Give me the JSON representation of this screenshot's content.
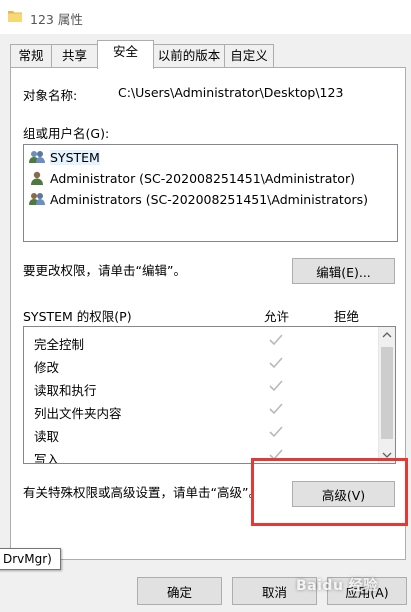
{
  "window": {
    "title": "123 属性"
  },
  "tabs": [
    {
      "label": "常规"
    },
    {
      "label": "共享"
    },
    {
      "label": "安全"
    },
    {
      "label": "以前的版本"
    },
    {
      "label": "自定义"
    }
  ],
  "security": {
    "object_label": "对象名称:",
    "object_value": "C:\\Users\\Administrator\\Desktop\\123",
    "groups_label": "组或用户名(G):",
    "groups": [
      {
        "name": "SYSTEM"
      },
      {
        "name": "Administrator (SC-202008251451\\Administrator)"
      },
      {
        "name": "Administrators (SC-202008251451\\Administrators)"
      }
    ],
    "change_hint": "要更改权限，请单击“编辑”。",
    "edit_button": "编辑(E)...",
    "perm_label": "SYSTEM 的权限(P)",
    "allow_header": "允许",
    "deny_header": "拒绝",
    "permissions": [
      {
        "name": "完全控制",
        "allow": true
      },
      {
        "name": "修改",
        "allow": true
      },
      {
        "name": "读取和执行",
        "allow": true
      },
      {
        "name": "列出文件夹内容",
        "allow": true
      },
      {
        "name": "读取",
        "allow": true
      },
      {
        "name": "写入",
        "allow": true
      }
    ],
    "advanced_hint": "有关特殊权限或高级设置，请单击“高级”。",
    "advanced_button": "高级(V)"
  },
  "tooltip": "DrvMgr)",
  "buttons": {
    "ok": "确定",
    "cancel": "取消",
    "apply": "应用(A)"
  },
  "watermark": "Baidu 经验",
  "colors": {
    "highlight": "#e53935",
    "selection": "#e5f3ff",
    "check": "#b9b9b9"
  }
}
